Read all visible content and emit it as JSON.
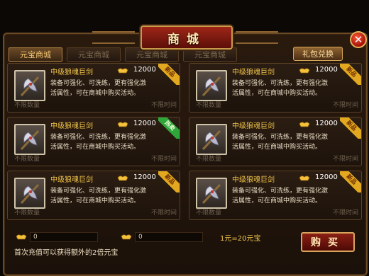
{
  "window": {
    "title": "商城",
    "close_label": "✕"
  },
  "tabs": [
    {
      "label": "元宝商城",
      "active": true
    },
    {
      "label": "元宝商城",
      "active": false
    },
    {
      "label": "元宝商城",
      "active": false
    },
    {
      "label": "元宝商城",
      "active": false
    }
  ],
  "gift_button": "礼包兑换",
  "items": [
    {
      "name": "中级狼魂巨剑",
      "price": "12000",
      "desc": "装备可强化、可洗练，更有强化激活属性，可在商城中购买活动。",
      "qty": "不限数量",
      "time": "不限时间",
      "badge": "新品",
      "badge_color": "gold"
    },
    {
      "name": "中级狼魂巨剑",
      "price": "12000",
      "desc": "装备可强化、可洗练，更有强化激活属性，可在商城中购买活动。",
      "qty": "不限数量",
      "time": "不限时间",
      "badge": "新品",
      "badge_color": "gold"
    },
    {
      "name": "中级狼魂巨剑",
      "price": "12000",
      "desc": "装备可强化、可洗练，更有强化激活属性，可在商城中购买活动。",
      "qty": "不限数量",
      "time": "不限时间",
      "badge": "热卖",
      "badge_color": "green"
    },
    {
      "name": "中级狼魂巨剑",
      "price": "12000",
      "desc": "装备可强化、可洗练，更有强化激活属性，可在商城中购买活动。",
      "qty": "不限数量",
      "time": "不限时间",
      "badge": "新品",
      "badge_color": "gold"
    },
    {
      "name": "中级狼魂巨剑",
      "price": "12000",
      "desc": "装备可强化、可洗练，更有强化激活属性，可在商城中购买活动。",
      "qty": "不限数量",
      "time": "不限时间",
      "badge": "新品",
      "badge_color": "gold"
    },
    {
      "name": "中级狼魂巨剑",
      "price": "12000",
      "desc": "装备可强化、可洗练，更有强化激活属性，可在商城中购买活动。",
      "qty": "不限数量",
      "time": "不限时间",
      "badge": "新品",
      "badge_color": "gold"
    }
  ],
  "bottom": {
    "currency1": "0",
    "currency2": "0",
    "rate": "1元=20元宝",
    "tip": "首次充值可以获得额外的2倍元宝",
    "buy_label": "购买"
  },
  "colors": {
    "gold_text": "#f1c54a",
    "frame": "#6b4a25",
    "badge_gold": "#e2a81f",
    "badge_green": "#2fa63a"
  },
  "icons": {
    "item": "battle-axe-icon",
    "price": "gold-ingot-icon",
    "close": "close-icon"
  }
}
